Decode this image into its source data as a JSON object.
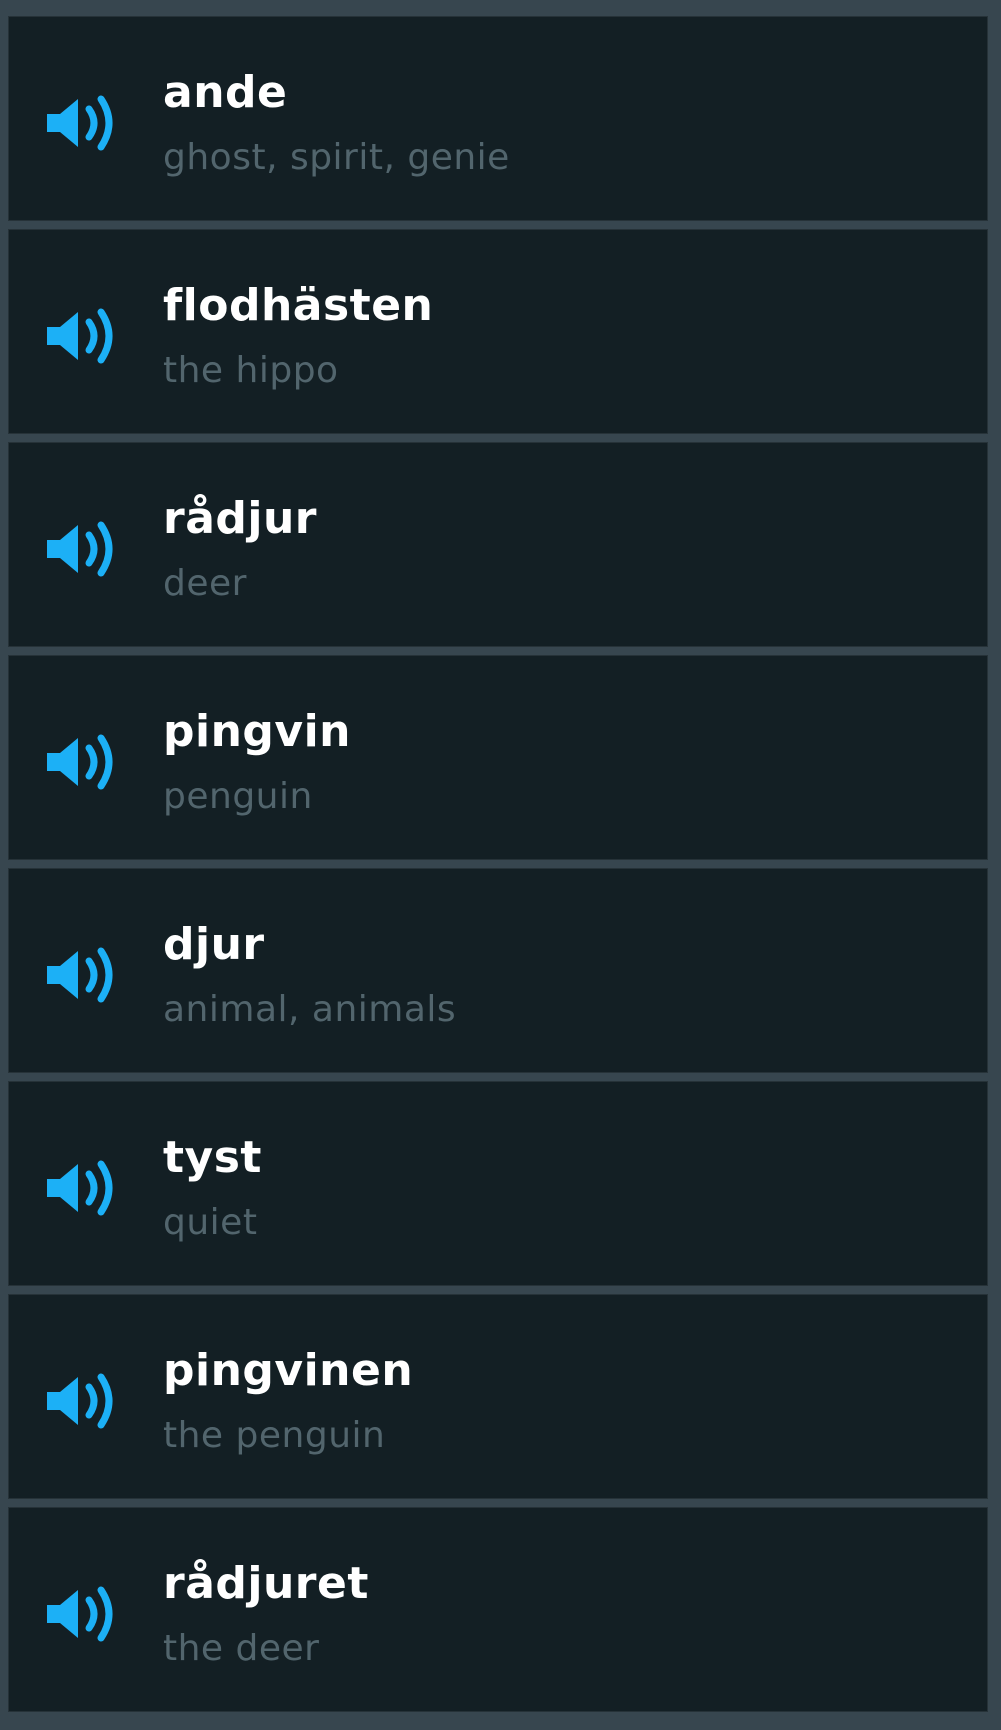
{
  "accent_color": "#1cb0f6",
  "icons": {
    "speaker": "speaker-icon"
  },
  "words": [
    {
      "word": "ande",
      "translation": "ghost, spirit, genie"
    },
    {
      "word": "flodhästen",
      "translation": "the hippo"
    },
    {
      "word": "rådjur",
      "translation": "deer"
    },
    {
      "word": "pingvin",
      "translation": "penguin"
    },
    {
      "word": "djur",
      "translation": "animal, animals"
    },
    {
      "word": "tyst",
      "translation": "quiet"
    },
    {
      "word": "pingvinen",
      "translation": "the penguin"
    },
    {
      "word": "rådjuret",
      "translation": "the deer"
    }
  ]
}
